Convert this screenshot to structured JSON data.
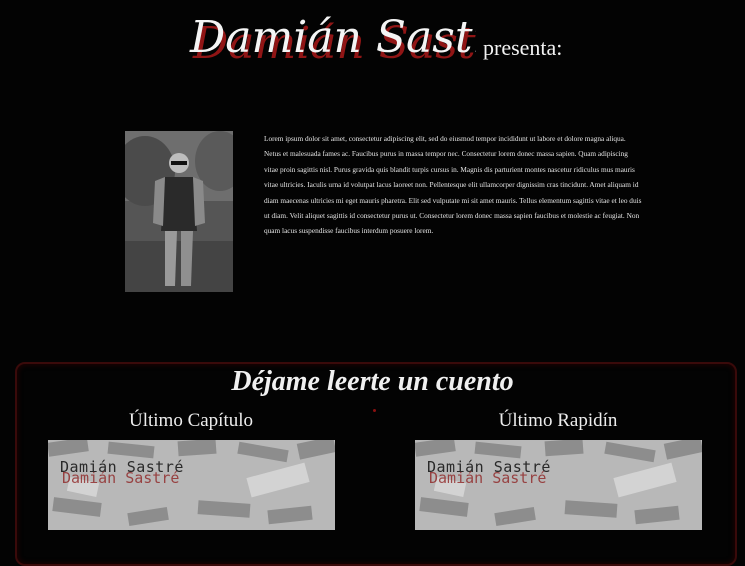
{
  "header": {
    "logo_text": "Damián Sastré",
    "presenta": "presenta:"
  },
  "author": {
    "photo_alt": "author-photo"
  },
  "bio": {
    "text": "Lorem ipsum dolor sit amet, consectetur adipiscing elit, sed do eiusmod tempor incididunt ut labore et dolore magna aliqua. Netus et malesuada fames ac. Faucibus purus in massa tempor nec. Consectetur lorem donec massa sapien. Quam adipiscing vitae proin sagittis nisl. Purus gravida quis blandit turpis cursus in. Magnis dis parturient montes nascetur ridiculus mus mauris vitae ultricies. Iaculis urna id volutpat lacus laoreet non. Pellentesque elit ullamcorper dignissim cras tincidunt. Amet aliquam id diam maecenas ultricies mi eget mauris pharetra. Elit sed vulputate mi sit amet mauris. Tellus elementum sagittis vitae et leo duis ut diam. Velit aliquet sagittis id consectetur purus ut. Consectetur lorem donec massa sapien faucibus et molestie ac feugiat. Non quam lacus suspendisse faucibus interdum posuere lorem."
  },
  "stories": {
    "title": "Déjame leerte un cuento",
    "chapter": {
      "heading": "Último Capítulo",
      "cover_title": "Damián Sastré",
      "cover_signature": "Sastré"
    },
    "rapidin": {
      "heading": "Último Rapidín",
      "cover_title": "Damián Sastré",
      "cover_signature": "Sastré"
    }
  }
}
